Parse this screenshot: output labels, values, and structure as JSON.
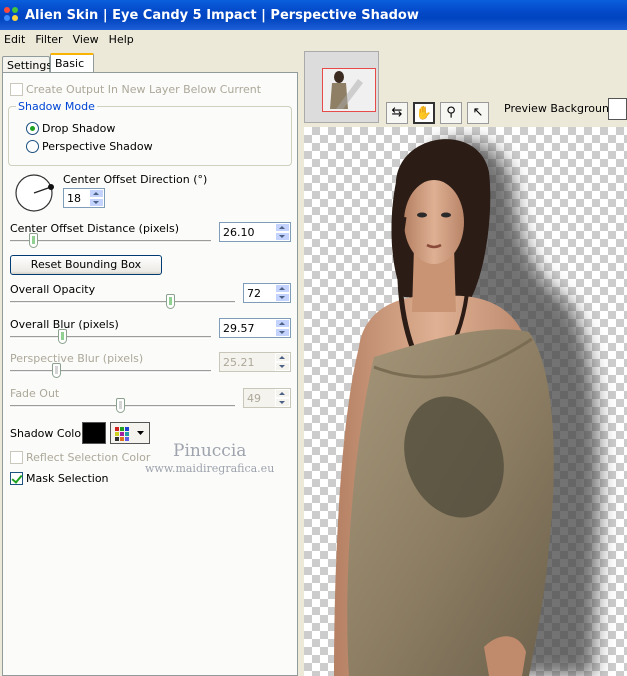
{
  "window": {
    "title": "Alien Skin  |  Eye Candy 5 Impact  |  Perspective Shadow"
  },
  "menu": [
    "Edit",
    "Filter",
    "View",
    "Help"
  ],
  "tabs": [
    "Settings",
    "Basic"
  ],
  "basic": {
    "create_output_label": "Create Output In New Layer Below Current",
    "shadow_mode_label": "Shadow Mode",
    "drop_shadow_label": "Drop Shadow",
    "perspective_shadow_label": "Perspective Shadow",
    "center_offset_direction_label": "Center Offset Direction (°)",
    "center_offset_direction_value": "18",
    "center_offset_distance_label": "Center Offset Distance (pixels)",
    "center_offset_distance_value": "26.10",
    "reset_bounding_box_label": "Reset Bounding Box",
    "overall_opacity_label": "Overall Opacity",
    "overall_opacity_value": "72",
    "overall_blur_label": "Overall Blur (pixels)",
    "overall_blur_value": "29.57",
    "perspective_blur_label": "Perspective Blur (pixels)",
    "perspective_blur_value": "25.21",
    "fade_out_label": "Fade Out",
    "fade_out_value": "49",
    "shadow_color_label": "Shadow Color",
    "shadow_color": "#000000",
    "reflect_selection_color_label": "Reflect Selection Color",
    "mask_selection_label": "Mask Selection"
  },
  "slider_levels": {
    "center_offset_distance": 0.1,
    "overall_opacity": 0.72,
    "overall_blur": 0.25,
    "perspective_blur": 0.22,
    "fade_out": 0.49
  },
  "preview": {
    "background_label": "Preview Background:",
    "tools": [
      "compare-icon",
      "hand-pan-icon",
      "zoom-icon",
      "pointer-icon"
    ]
  },
  "watermark": {
    "line1": "Pinuccia",
    "line2": "www.maidiregrafica.eu"
  }
}
